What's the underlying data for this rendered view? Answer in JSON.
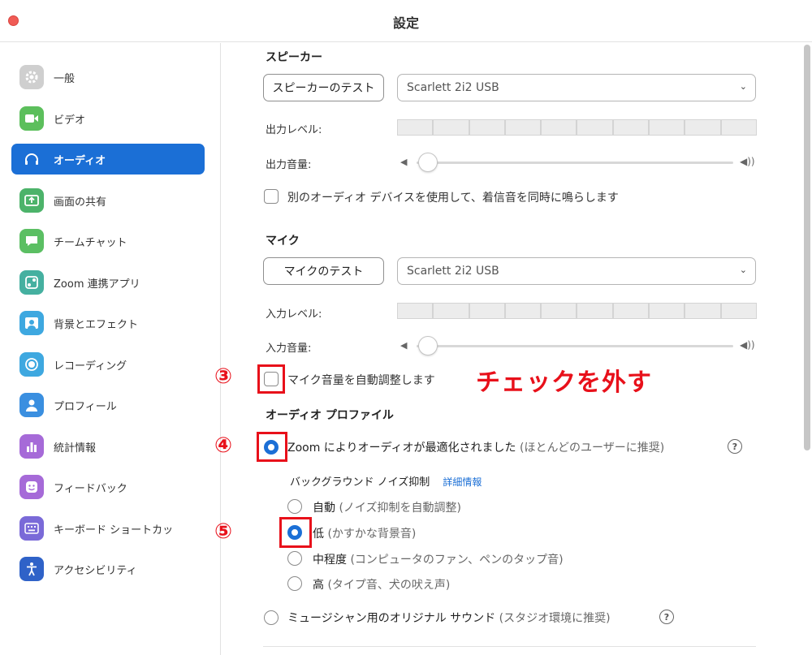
{
  "window": {
    "title": "設定"
  },
  "sidebar": {
    "items": [
      {
        "label": "一般",
        "icon": "gear-icon",
        "color": "#c8c8c8"
      },
      {
        "label": "ビデオ",
        "icon": "video-camera-icon",
        "color": "#5cbf5c"
      },
      {
        "label": "オーディオ",
        "icon": "headphones-icon",
        "color": "#1b6fd6",
        "active": true
      },
      {
        "label": "画面の共有",
        "icon": "share-screen-icon",
        "color": "#4cb36a"
      },
      {
        "label": "チームチャット",
        "icon": "chat-icon",
        "color": "#5bbf63"
      },
      {
        "label": "Zoom 連携アプリ",
        "icon": "apps-icon",
        "color": "#45b0a0"
      },
      {
        "label": "背景とエフェクト",
        "icon": "background-icon",
        "color": "#3ea8e0"
      },
      {
        "label": "レコーディング",
        "icon": "record-icon",
        "color": "#3ea8e0"
      },
      {
        "label": "プロフィール",
        "icon": "profile-icon",
        "color": "#3a8fe0"
      },
      {
        "label": "統計情報",
        "icon": "stats-icon",
        "color": "#a66ad8"
      },
      {
        "label": "フィードバック",
        "icon": "feedback-icon",
        "color": "#a66ad8"
      },
      {
        "label": "キーボード ショートカッ",
        "icon": "keyboard-icon",
        "color": "#7a6ad8"
      },
      {
        "label": "アクセシビリティ",
        "icon": "accessibility-icon",
        "color": "#2f62c8"
      }
    ]
  },
  "speaker": {
    "section_title": "スピーカー",
    "test_button": "スピーカーのテスト",
    "device": "Scarlett 2i2 USB",
    "output_level_label": "出力レベル:",
    "output_volume_label": "出力音量:",
    "level_segments": 10,
    "volume_value": 0,
    "separate_device_label": "別のオーディオ デバイスを使用して、着信音を同時に鳴らします"
  },
  "mic": {
    "section_title": "マイク",
    "test_button": "マイクのテスト",
    "device": "Scarlett 2i2 USB",
    "input_level_label": "入力レベル:",
    "input_volume_label": "入力音量:",
    "level_segments": 10,
    "volume_value": 0,
    "auto_adjust_label": "マイク音量を自動調整します"
  },
  "profile": {
    "section_title": "オーディオ プロファイル",
    "zoom_optimized": "Zoom によりオーディオが最適化されました",
    "zoom_optimized_note": "(ほとんどのユーザーに推奨)",
    "noise_label": "バックグラウンド ノイズ抑制",
    "noise_link": "詳細情報",
    "options": [
      {
        "label": "自動",
        "note": "(ノイズ抑制を自動調整)",
        "selected": false
      },
      {
        "label": "低",
        "note": "(かすかな背景音)",
        "selected": true
      },
      {
        "label": "中程度",
        "note": "(コンピュータのファン、ペンのタップ音)",
        "selected": false
      },
      {
        "label": "高",
        "note": "(タイプ音、犬の吠え声)",
        "selected": false
      }
    ],
    "musician_label": "ミュージシャン用のオリジナル サウンド",
    "musician_note": "(スタジオ環境に推奨)"
  },
  "annotations": {
    "step3": "③",
    "step4": "④",
    "step5": "⑤",
    "instruction": "チェックを外す",
    "color": "#e8101a"
  }
}
